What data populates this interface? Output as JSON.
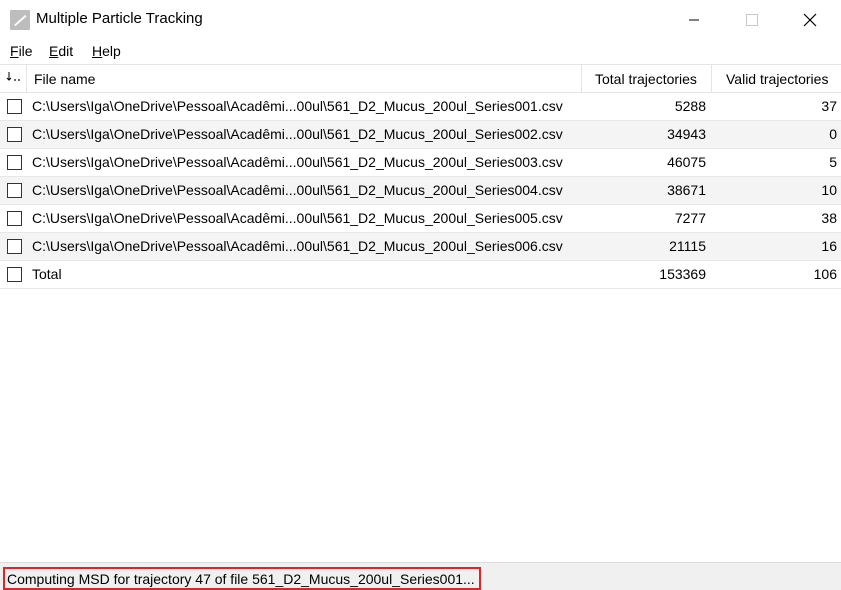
{
  "window": {
    "title": "Multiple Particle Tracking",
    "controls": [
      "minimize",
      "maximize",
      "close"
    ]
  },
  "menu": [
    {
      "label": "File",
      "mnemonic": "F",
      "rest": "ile"
    },
    {
      "label": "Edit",
      "mnemonic": "E",
      "rest": "dit"
    },
    {
      "label": "Help",
      "mnemonic": "H",
      "rest": "elp"
    }
  ],
  "table": {
    "columns": {
      "check": "",
      "file_name": "File name",
      "total": "Total trajectories",
      "valid": "Valid trajectories"
    },
    "rows": [
      {
        "file": "C:\\Users\\Iga\\OneDrive\\Pessoal\\Acadêmi...00ul\\561_D2_Mucus_200ul_Series001.csv",
        "total": "5288",
        "valid": "37"
      },
      {
        "file": "C:\\Users\\Iga\\OneDrive\\Pessoal\\Acadêmi...00ul\\561_D2_Mucus_200ul_Series002.csv",
        "total": "34943",
        "valid": "0"
      },
      {
        "file": "C:\\Users\\Iga\\OneDrive\\Pessoal\\Acadêmi...00ul\\561_D2_Mucus_200ul_Series003.csv",
        "total": "46075",
        "valid": "5"
      },
      {
        "file": "C:\\Users\\Iga\\OneDrive\\Pessoal\\Acadêmi...00ul\\561_D2_Mucus_200ul_Series004.csv",
        "total": "38671",
        "valid": "10"
      },
      {
        "file": "C:\\Users\\Iga\\OneDrive\\Pessoal\\Acadêmi...00ul\\561_D2_Mucus_200ul_Series005.csv",
        "total": "7277",
        "valid": "38"
      },
      {
        "file": "C:\\Users\\Iga\\OneDrive\\Pessoal\\Acadêmi...00ul\\561_D2_Mucus_200ul_Series006.csv",
        "total": "21115",
        "valid": "16"
      }
    ],
    "total_row": {
      "file": "Total",
      "total": "153369",
      "valid": "106"
    }
  },
  "status": {
    "text": "Computing MSD for trajectory 47 of file 561_D2_Mucus_200ul_Series001...",
    "highlight_color": "#d9262b"
  }
}
